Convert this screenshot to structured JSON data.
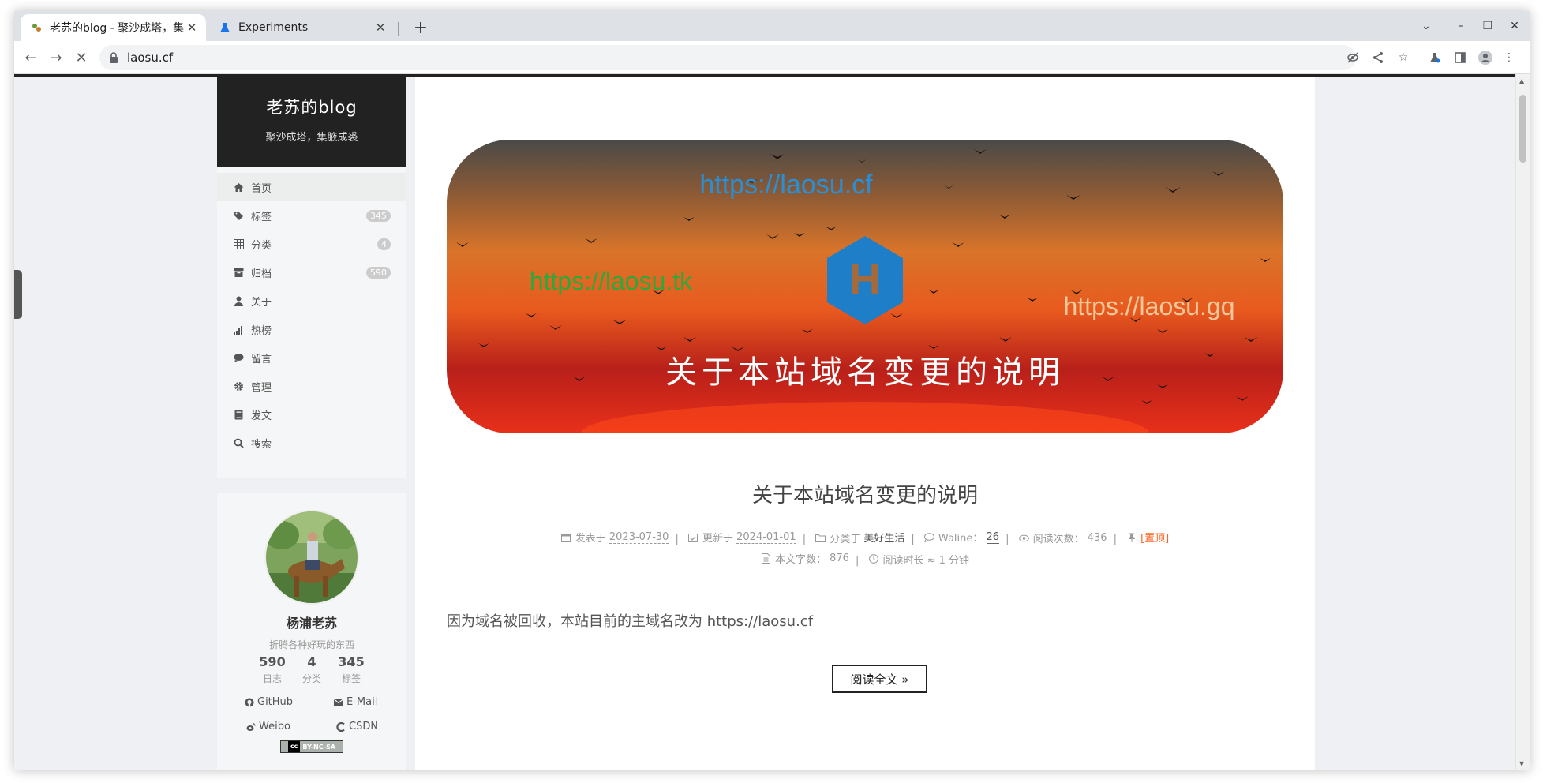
{
  "browser": {
    "tabs": [
      {
        "title": "老苏的blog - 聚沙成塔，集腋成裘",
        "active": true
      },
      {
        "title": "Experiments",
        "active": false
      }
    ],
    "url": "laosu.cf"
  },
  "site": {
    "title": "老苏的blog",
    "subtitle": "聚沙成塔，集腋成裘"
  },
  "menu": {
    "items": [
      {
        "label": "首页",
        "icon": "home-icon",
        "badge": ""
      },
      {
        "label": "标签",
        "icon": "tags-icon",
        "badge": "345"
      },
      {
        "label": "分类",
        "icon": "grid-icon",
        "badge": "4"
      },
      {
        "label": "归档",
        "icon": "archive-icon",
        "badge": "590"
      },
      {
        "label": "关于",
        "icon": "user-icon",
        "badge": ""
      },
      {
        "label": "热榜",
        "icon": "signal-icon",
        "badge": ""
      },
      {
        "label": "留言",
        "icon": "comment-icon",
        "badge": ""
      },
      {
        "label": "管理",
        "icon": "gear-icon",
        "badge": ""
      },
      {
        "label": "发文",
        "icon": "book-icon",
        "badge": ""
      },
      {
        "label": "搜索",
        "icon": "search-icon",
        "badge": ""
      }
    ]
  },
  "author": {
    "name": "杨浦老苏",
    "description": "折腾各种好玩的东西",
    "stats": [
      {
        "num": "590",
        "label": "日志"
      },
      {
        "num": "4",
        "label": "分类"
      },
      {
        "num": "345",
        "label": "标签"
      }
    ],
    "links": [
      {
        "label": "GitHub",
        "icon": "github-icon"
      },
      {
        "label": "E-Mail",
        "icon": "envelope-icon"
      },
      {
        "label": "Weibo",
        "icon": "weibo-icon"
      },
      {
        "label": "CSDN",
        "icon": "csdn-icon"
      }
    ],
    "license": {
      "left": "cc",
      "right": "BY-NC-SA"
    }
  },
  "banner": {
    "url_top": "https://laosu.cf",
    "url_left": "https://laosu.tk",
    "url_right": "https://laosu.gq",
    "logo_letter": "H",
    "caption": "关于本站域名变更的说明"
  },
  "post": {
    "title": "关于本站域名变更的说明",
    "meta": {
      "published_label": "发表于",
      "published": "2023-07-30",
      "updated_label": "更新于",
      "updated": "2024-01-01",
      "category_label": "分类于",
      "category": "美好生活",
      "comments_label": "Waline：",
      "comments": "26",
      "views_label": "阅读次数：",
      "views": "436",
      "sticky": "[置顶]",
      "words_label": "本文字数：",
      "words": "876",
      "reading_label": "阅读时长 ≈",
      "reading": "1 分钟"
    },
    "excerpt": "因为域名被回收，本站目前的主域名改为 https://laosu.cf",
    "read_more": "阅读全文 »"
  }
}
